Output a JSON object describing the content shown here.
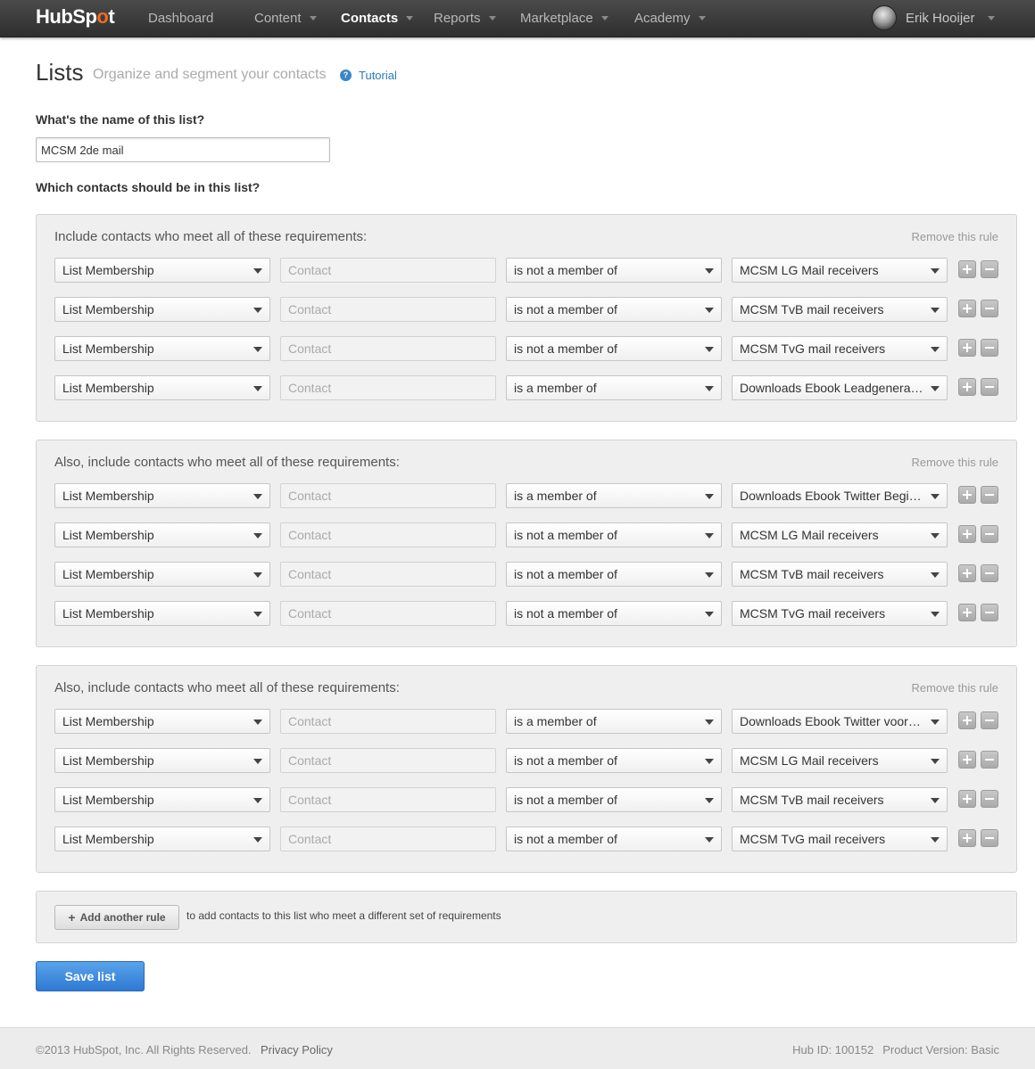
{
  "nav": {
    "logo_prefix": "HubSp",
    "logo_accent": "o",
    "logo_suffix": "t",
    "items": [
      {
        "label": "Dashboard",
        "dropdown": false,
        "active": false
      },
      {
        "label": "Content",
        "dropdown": true,
        "active": false
      },
      {
        "label": "Contacts",
        "dropdown": true,
        "active": true
      },
      {
        "label": "Reports",
        "dropdown": true,
        "active": false
      },
      {
        "label": "Marketplace",
        "dropdown": true,
        "active": false
      },
      {
        "label": "Academy",
        "dropdown": true,
        "active": false
      }
    ],
    "user_name": "Erik Hooijer"
  },
  "header": {
    "title": "Lists",
    "subtitle": "Organize and segment your contacts",
    "tutorial": "Tutorial"
  },
  "form": {
    "name_question": "What's the name of this list?",
    "name_value": "MCSM 2de mail",
    "contacts_question": "Which contacts should be in this list?"
  },
  "rules": [
    {
      "title": "Include contacts who meet all of these requirements:",
      "remove": "Remove this rule",
      "rows": [
        {
          "type": "List Membership",
          "context": "Contact",
          "operator": "is not a member of",
          "value": "MCSM LG Mail receivers"
        },
        {
          "type": "List Membership",
          "context": "Contact",
          "operator": "is not a member of",
          "value": "MCSM TvB mail receivers"
        },
        {
          "type": "List Membership",
          "context": "Contact",
          "operator": "is not a member of",
          "value": "MCSM TvG mail receivers"
        },
        {
          "type": "List Membership",
          "context": "Contact",
          "operator": "is a member of",
          "value": "Downloads Ebook Leadgeneratie"
        }
      ]
    },
    {
      "title": "Also, include contacts who meet all of these requirements:",
      "remove": "Remove this rule",
      "rows": [
        {
          "type": "List Membership",
          "context": "Contact",
          "operator": "is a member of",
          "value": "Downloads Ebook Twitter Begi…"
        },
        {
          "type": "List Membership",
          "context": "Contact",
          "operator": "is not a member of",
          "value": "MCSM LG Mail receivers"
        },
        {
          "type": "List Membership",
          "context": "Contact",
          "operator": "is not a member of",
          "value": "MCSM TvB mail receivers"
        },
        {
          "type": "List Membership",
          "context": "Contact",
          "operator": "is not a member of",
          "value": "MCSM TvG mail receivers"
        }
      ]
    },
    {
      "title": "Also, include contacts who meet all of these requirements:",
      "remove": "Remove this rule",
      "rows": [
        {
          "type": "List Membership",
          "context": "Contact",
          "operator": "is a member of",
          "value": "Downloads Ebook Twitter voor …"
        },
        {
          "type": "List Membership",
          "context": "Contact",
          "operator": "is not a member of",
          "value": "MCSM LG Mail receivers"
        },
        {
          "type": "List Membership",
          "context": "Contact",
          "operator": "is not a member of",
          "value": "MCSM TvB mail receivers"
        },
        {
          "type": "List Membership",
          "context": "Contact",
          "operator": "is not a member of",
          "value": "MCSM TvG mail receivers"
        }
      ]
    }
  ],
  "add_rule": {
    "button": "Add another rule",
    "text": "to add contacts to this list who meet a different set of requirements"
  },
  "save_button": "Save list",
  "footer": {
    "copyright": "©2013 HubSpot, Inc. All Rights Reserved.",
    "privacy": "Privacy Policy",
    "hub_id": "Hub ID: 100152",
    "product_version": "Product Version: Basic"
  }
}
